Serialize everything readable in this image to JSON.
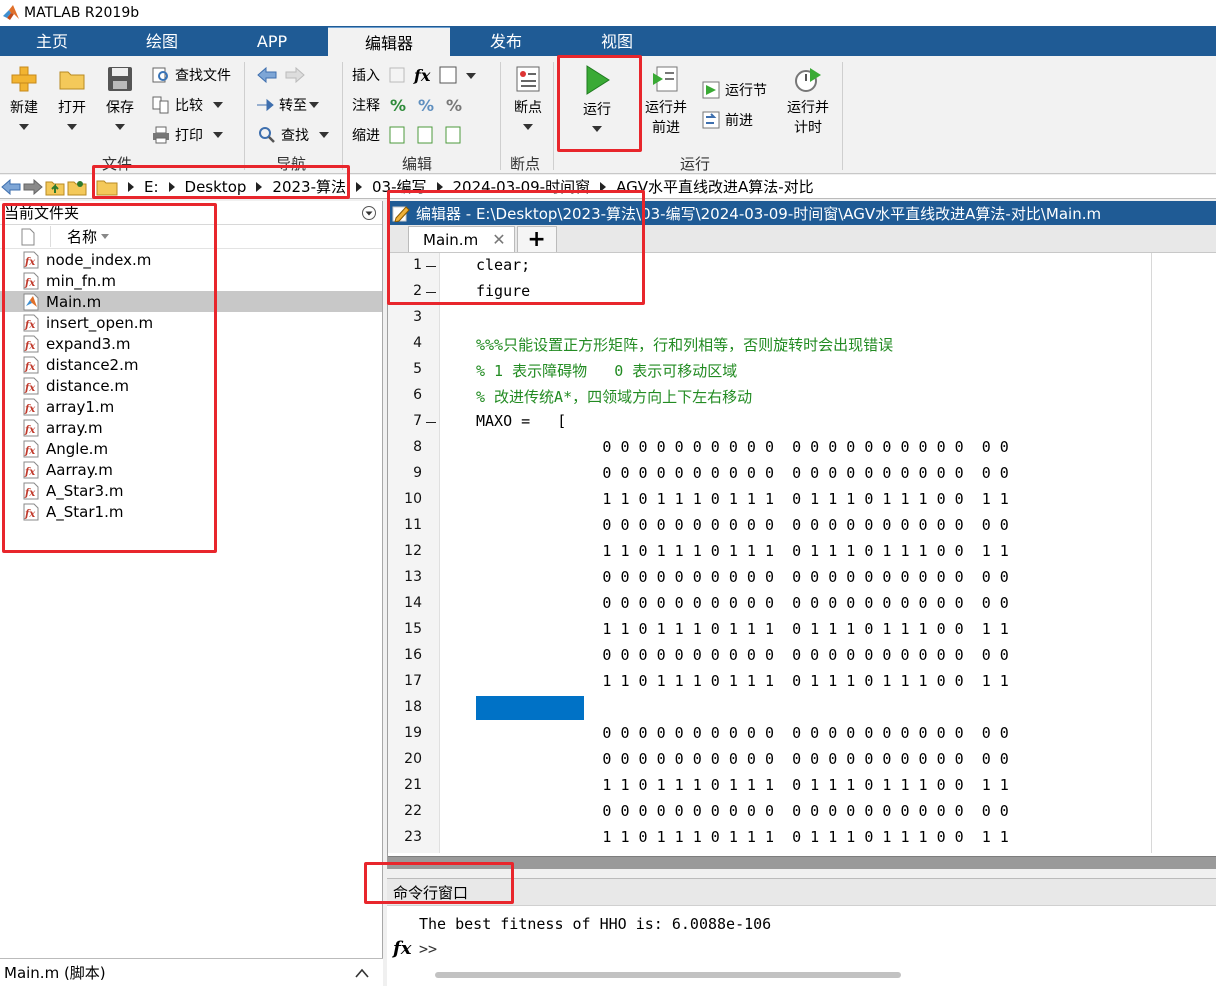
{
  "window": {
    "title": "MATLAB R2019b"
  },
  "tabs": [
    {
      "label": "主页",
      "active": false
    },
    {
      "label": "绘图",
      "active": false
    },
    {
      "label": "APP",
      "active": false
    },
    {
      "label": "编辑器",
      "active": true
    },
    {
      "label": "发布",
      "active": false
    },
    {
      "label": "视图",
      "active": false
    }
  ],
  "ribbon": {
    "file": {
      "new": "新建",
      "open": "打开",
      "save": "保存",
      "find_files": "查找文件",
      "compare": "比较",
      "print": "打印",
      "group": "文件"
    },
    "nav": {
      "goto": "转至",
      "find": "查找",
      "group": "导航"
    },
    "edit": {
      "insert": "插入",
      "comment": "注释",
      "indent": "缩进",
      "group": "编辑"
    },
    "breakpoints": {
      "label": "断点",
      "group": "断点"
    },
    "run": {
      "run": "运行",
      "run_advance_1": "运行并",
      "run_advance_2": "前进",
      "run_section": "运行节",
      "advance": "前进",
      "run_time_1": "运行并",
      "run_time_2": "计时",
      "group": "运行"
    }
  },
  "address": {
    "crumbs": [
      "E:",
      "Desktop",
      "2023-算法",
      "03-编写",
      "2024-03-09-时间窗",
      "AGV水平直线改进A算法-对比"
    ]
  },
  "file_panel": {
    "title": "当前文件夹",
    "column": "名称",
    "files": [
      {
        "name": "node_index.m",
        "selected": false
      },
      {
        "name": "min_fn.m",
        "selected": false
      },
      {
        "name": "Main.m",
        "selected": true
      },
      {
        "name": "insert_open.m",
        "selected": false
      },
      {
        "name": "expand3.m",
        "selected": false
      },
      {
        "name": "distance2.m",
        "selected": false
      },
      {
        "name": "distance.m",
        "selected": false
      },
      {
        "name": "array1.m",
        "selected": false
      },
      {
        "name": "array.m",
        "selected": false
      },
      {
        "name": "Angle.m",
        "selected": false
      },
      {
        "name": "Aarray.m",
        "selected": false
      },
      {
        "name": "A_Star3.m",
        "selected": false
      },
      {
        "name": "A_Star1.m",
        "selected": false
      }
    ]
  },
  "status": {
    "text": "Main.m  (脚本)"
  },
  "editor": {
    "title": "编辑器 - E:\\Desktop\\2023-算法\\03-编写\\2024-03-09-时间窗\\AGV水平直线改进A算法-对比\\Main.m",
    "tab": "Main.m",
    "lines": [
      {
        "n": "1",
        "dash": true,
        "text": "clear;",
        "comment": false
      },
      {
        "n": "2",
        "dash": true,
        "text": "figure",
        "comment": false
      },
      {
        "n": "3",
        "dash": false,
        "text": "",
        "comment": false
      },
      {
        "n": "4",
        "dash": false,
        "text": "%%%只能设置正方形矩阵，行和列相等，否则旋转时会出现错误",
        "comment": true
      },
      {
        "n": "5",
        "dash": false,
        "text": "% 1 表示障碍物   0 表示可移动区域",
        "comment": true
      },
      {
        "n": "6",
        "dash": false,
        "text": "% 改进传统A*，四领域方向上下左右移动",
        "comment": true
      },
      {
        "n": "7",
        "dash": true,
        "text": "MAXO =   [",
        "comment": false
      },
      {
        "n": "8",
        "dash": false,
        "text": "              0 0 0 0 0 0 0 0 0 0  0 0 0 0 0 0 0 0 0 0  0 0",
        "comment": false
      },
      {
        "n": "9",
        "dash": false,
        "text": "              0 0 0 0 0 0 0 0 0 0  0 0 0 0 0 0 0 0 0 0  0 0",
        "comment": false
      },
      {
        "n": "10",
        "dash": false,
        "text": "              1 1 0 1 1 1 0 1 1 1  0 1 1 1 0 1 1 1 0 0  1 1",
        "comment": false
      },
      {
        "n": "11",
        "dash": false,
        "text": "              0 0 0 0 0 0 0 0 0 0  0 0 0 0 0 0 0 0 0 0  0 0",
        "comment": false
      },
      {
        "n": "12",
        "dash": false,
        "text": "              1 1 0 1 1 1 0 1 1 1  0 1 1 1 0 1 1 1 0 0  1 1",
        "comment": false
      },
      {
        "n": "13",
        "dash": false,
        "text": "              0 0 0 0 0 0 0 0 0 0  0 0 0 0 0 0 0 0 0 0  0 0",
        "comment": false
      },
      {
        "n": "14",
        "dash": false,
        "text": "              0 0 0 0 0 0 0 0 0 0  0 0 0 0 0 0 0 0 0 0  0 0",
        "comment": false
      },
      {
        "n": "15",
        "dash": false,
        "text": "              1 1 0 1 1 1 0 1 1 1  0 1 1 1 0 1 1 1 0 0  1 1",
        "comment": false
      },
      {
        "n": "16",
        "dash": false,
        "text": "              0 0 0 0 0 0 0 0 0 0  0 0 0 0 0 0 0 0 0 0  0 0",
        "comment": false
      },
      {
        "n": "17",
        "dash": false,
        "text": "              1 1 0 1 1 1 0 1 1 1  0 1 1 1 0 1 1 1 0 0  1 1",
        "comment": false
      },
      {
        "n": "18",
        "dash": false,
        "text": "",
        "comment": false,
        "selected": true
      },
      {
        "n": "19",
        "dash": false,
        "text": "              0 0 0 0 0 0 0 0 0 0  0 0 0 0 0 0 0 0 0 0  0 0",
        "comment": false
      },
      {
        "n": "20",
        "dash": false,
        "text": "              0 0 0 0 0 0 0 0 0 0  0 0 0 0 0 0 0 0 0 0  0 0",
        "comment": false
      },
      {
        "n": "21",
        "dash": false,
        "text": "              1 1 0 1 1 1 0 1 1 1  0 1 1 1 0 1 1 1 0 0  1 1",
        "comment": false
      },
      {
        "n": "22",
        "dash": false,
        "text": "              0 0 0 0 0 0 0 0 0 0  0 0 0 0 0 0 0 0 0 0  0 0",
        "comment": false
      },
      {
        "n": "23",
        "dash": false,
        "text": "              1 1 0 1 1 1 0 1 1 1  0 1 1 1 0 1 1 1 0 0  1 1",
        "comment": false
      }
    ]
  },
  "command_window": {
    "title": "命令行窗口",
    "output": "The best fitness of HHO is: 6.0088e-106",
    "prompt": ">>",
    "fx": "fx"
  },
  "colors": {
    "tab_bar": "#1f5b95",
    "comment": "#228b22",
    "selection": "#0072c6",
    "highlight": "#e8262c"
  }
}
